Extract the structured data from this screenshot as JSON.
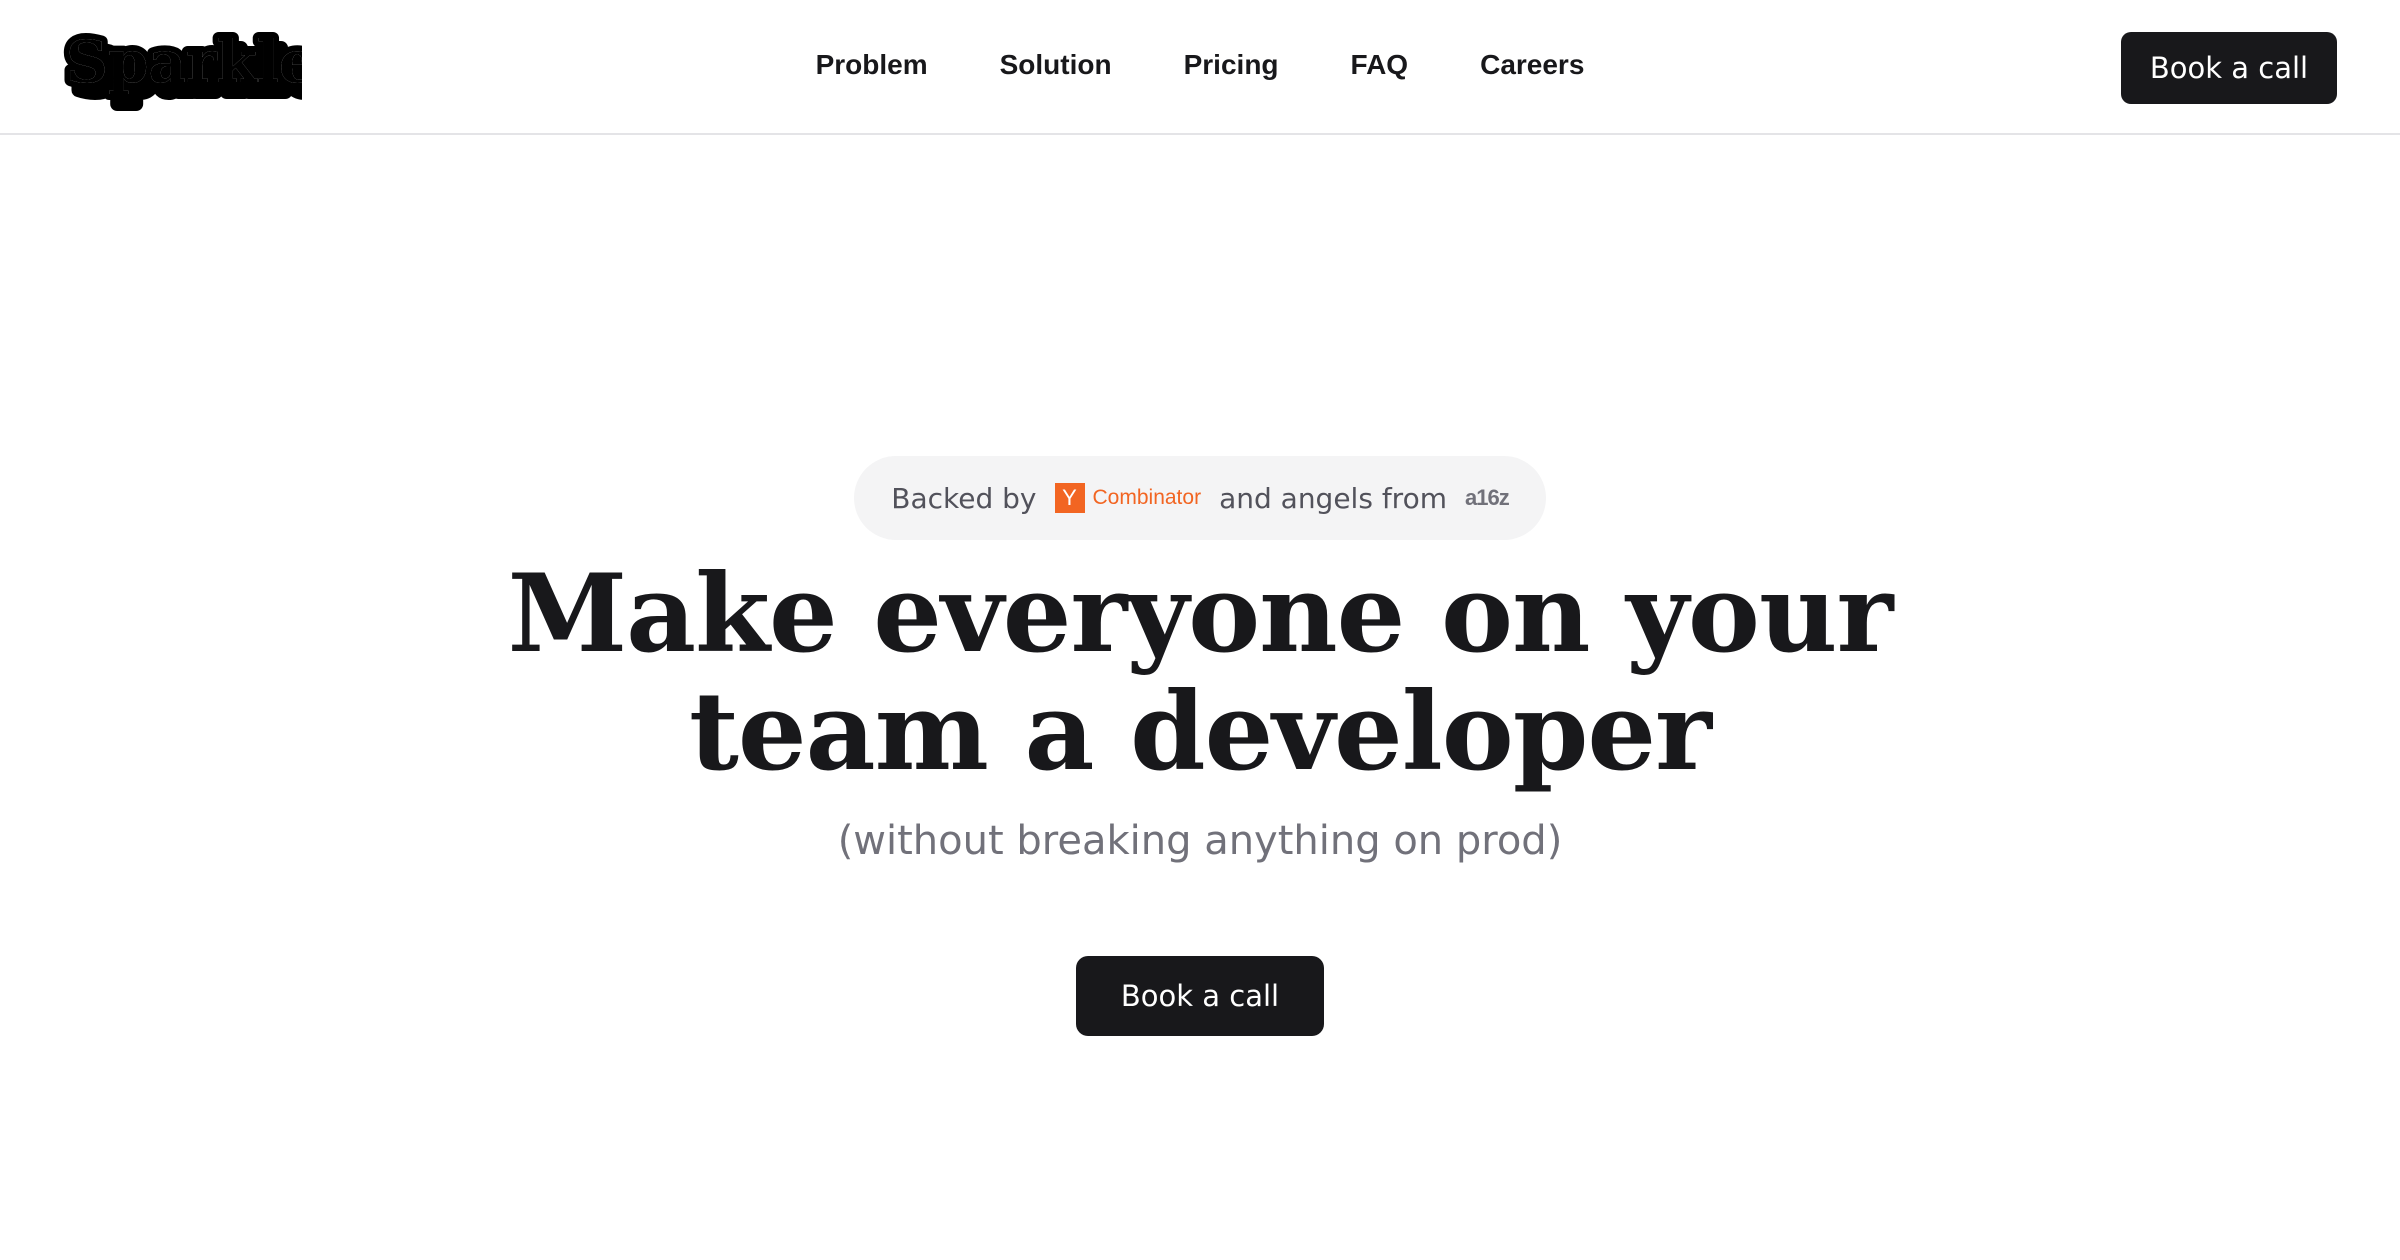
{
  "header": {
    "logo_text": "Sparkles",
    "nav": [
      {
        "label": "Problem"
      },
      {
        "label": "Solution"
      },
      {
        "label": "Pricing"
      },
      {
        "label": "FAQ"
      },
      {
        "label": "Careers"
      }
    ],
    "cta_label": "Book a call"
  },
  "hero": {
    "backed": {
      "prefix": "Backed by",
      "yc_letter": "Y",
      "yc_word": "Combinator",
      "middle": "and angels from",
      "investor_logo": "a16z"
    },
    "headline_line1": "Make everyone on your",
    "headline_line2": "team a developer",
    "subheadline": "(without breaking anything on prod)",
    "cta_label": "Book a call"
  },
  "colors": {
    "primary": "#18181b",
    "muted_text": "#71717a",
    "pill_bg": "#f4f4f5",
    "yc_orange": "#f26522"
  }
}
